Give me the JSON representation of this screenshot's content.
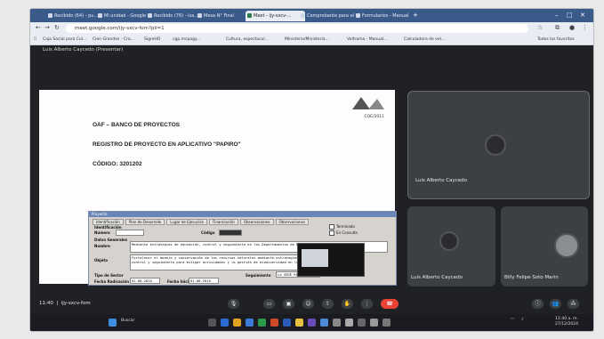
{
  "browser": {
    "tabs": [
      "Recibido (64) - pu...",
      "Mi unidad - Google",
      "Recibido (76) - lus...",
      "Mesa N° Final",
      "Meet - ijy-sxcv-...",
      "Comprobante para el ...",
      "Formularios - Manual"
    ],
    "url": "meet.google.com/ijy-sxcv-fom?pli=1",
    "bookmarks": [
      "Caja Social para Cul...",
      "Cien Grandes - Cra...",
      "SigreHO",
      "cgp.mcpagy...",
      "Cultura, espectacul...",
      "Ministerio/Ministeria...",
      "Voltrama - Manual...",
      "Calculadora de vel..."
    ],
    "bookmarks_right": "Todos los favoritos"
  },
  "meet": {
    "presenter_label": "Luis Alberto Caycedo (Presentar)",
    "shared_doc": {
      "code_label": "COE/2011",
      "heading1": "OAF – BANCO DE PROYECTOS",
      "heading2": "REGISTRO DE PROYECTO EN APLICATIVO \"PAPIRO\"",
      "heading3": "CÓDIGO: 3201202",
      "app_title": "Proyecto",
      "app_tabs": [
        "Identificación",
        "Plan de Desarrollo",
        "Lugar de Ejecución",
        "Financiación",
        "Observaciones",
        "Observaciones"
      ],
      "section_label": "Identificación",
      "numero_label": "Número",
      "codigo_label": "Código",
      "check1": "Terminado",
      "check2": "En Consulta",
      "datos_label": "Datos Generales",
      "nombre_label": "Nombre",
      "nombre_text": "Mediante estrategias de educación, control y seguimiento en los Departamentos de Boyacá, Santander y Vaupés",
      "objeto_label": "Objeto",
      "objeto_text": "Fortalecer el manejo y conservación de los recursos naturales mediante estrategias de educación, control y seguimiento para mitigar actividades y la gestión de biodiversidad en los departamentos",
      "tipo_label": "Tipo de Sector",
      "fecha_label": "Fecha Radicación",
      "fecha_value": "01-08-2016",
      "fecha2_label": "Fecha Inicial",
      "fecha2_value": "01-08-2016",
      "seguimiento_label": "Seguimiento",
      "seguimiento_value": "La SEDE REGIONAL"
    },
    "participants": [
      {
        "name": "Luis Alberto Caycedo"
      },
      {
        "name": "Luis Alberto Caycedo"
      },
      {
        "name": "Billy Felipe Soto Marin"
      }
    ],
    "controls": {
      "time": "11:40",
      "meeting_code": "ijy-sxcv-fom"
    }
  },
  "taskbar": {
    "search_label": "Buscar",
    "clock_time": "11:40 a. m.",
    "clock_date": "27/12/2024"
  },
  "colors": {
    "tab_strip": "#3a5a8a",
    "meet_bg": "#202124",
    "tile_bg": "#3c4043",
    "end_call": "#ea4335"
  }
}
